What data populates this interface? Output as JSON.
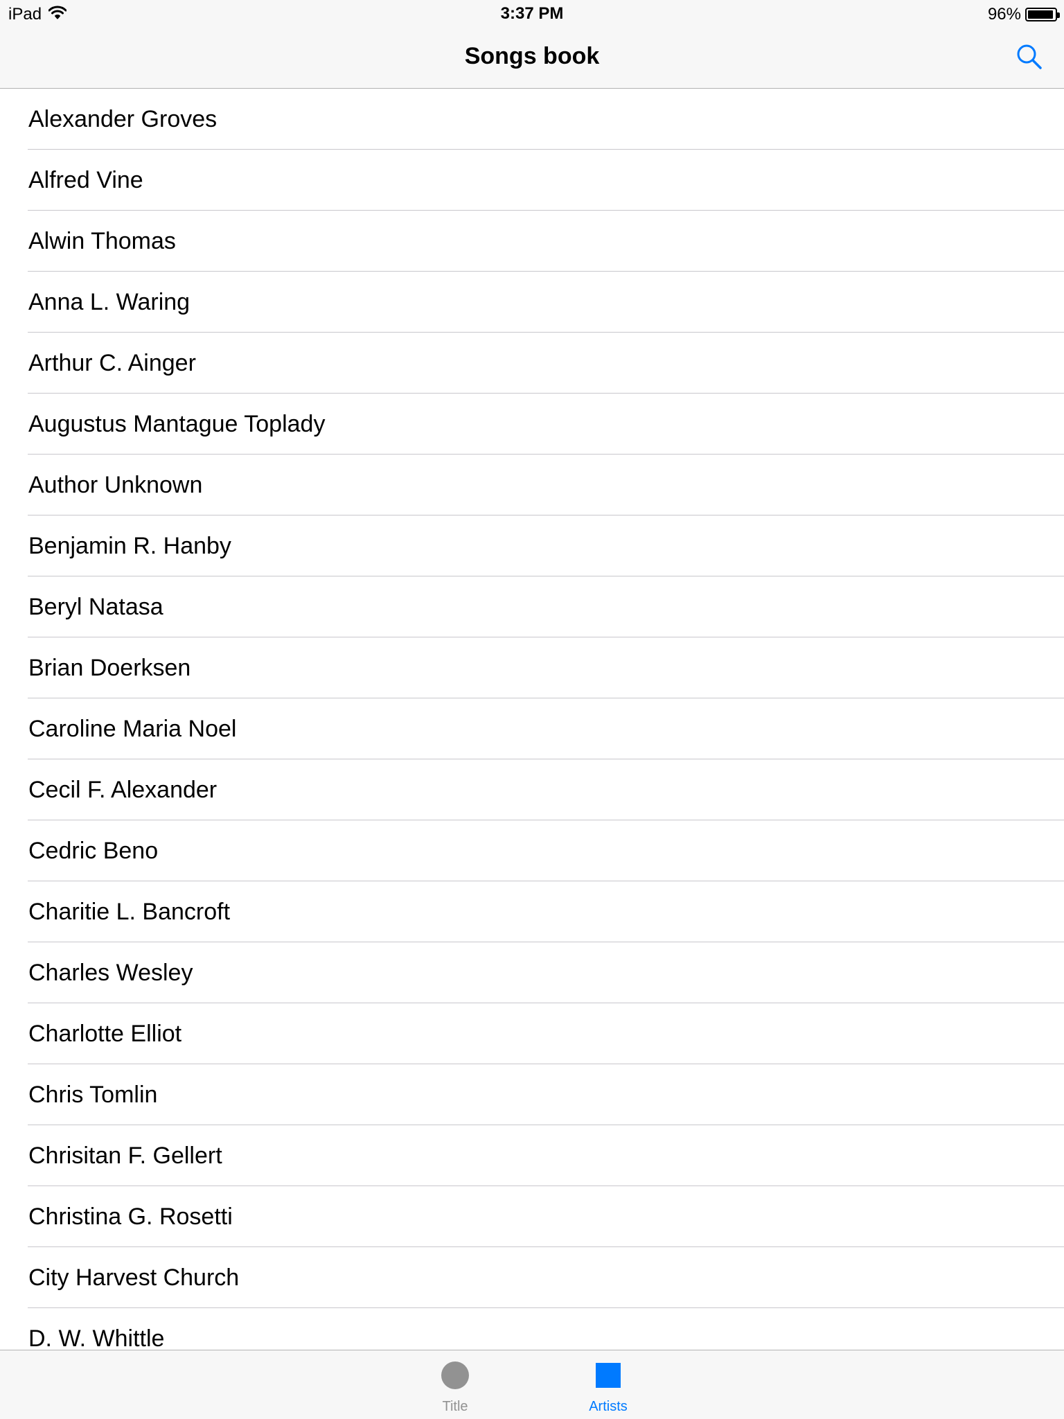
{
  "status_bar": {
    "device": "iPad",
    "time": "3:37 PM",
    "battery_percent": "96%",
    "battery_level": 0.96,
    "wifi_icon": "wifi-icon",
    "battery_icon": "battery-icon"
  },
  "nav": {
    "title": "Songs book",
    "search_icon": "search-icon"
  },
  "artists": [
    "Alexander Groves",
    "Alfred Vine",
    "Alwin Thomas",
    "Anna L. Waring",
    "Arthur C. Ainger",
    "Augustus Mantague Toplady",
    "Author Unknown",
    "Benjamin R. Hanby",
    "Beryl Natasa",
    "Brian Doerksen",
    "Caroline Maria Noel",
    "Cecil F. Alexander",
    "Cedric Beno",
    "Charitie L. Bancroft",
    "Charles Wesley",
    "Charlotte Elliot",
    "Chris Tomlin",
    "Chrisitan F. Gellert",
    "Christina G. Rosetti",
    "City Harvest Church",
    "D. W. Whittle"
  ],
  "tab_bar": {
    "tabs": [
      {
        "label": "Title",
        "icon": "circle-icon",
        "selected": false
      },
      {
        "label": "Artists",
        "icon": "square-icon",
        "selected": true
      }
    ]
  },
  "colors": {
    "accent": "#007aff",
    "inactive": "#929292",
    "bar_background": "#f7f7f7",
    "separator": "#c8c7cc"
  }
}
